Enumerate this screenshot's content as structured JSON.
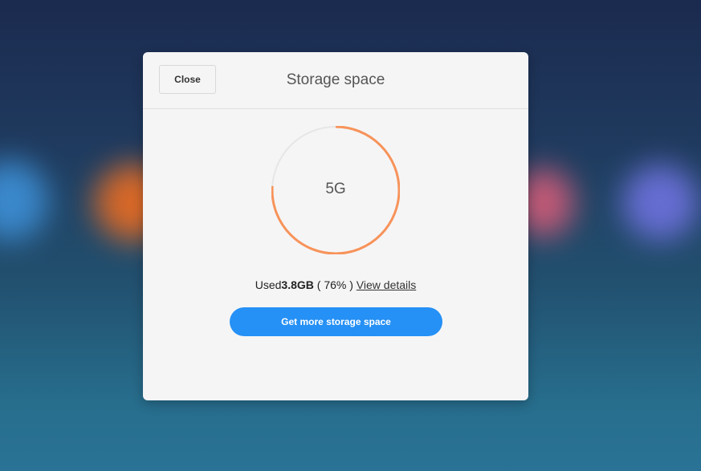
{
  "dialog": {
    "close_label": "Close",
    "title": "Storage space"
  },
  "storage": {
    "capacity_label": "5G",
    "used_prefix": "Used",
    "used_amount": "3.8GB",
    "used_percent_text": "( 76% )",
    "used_fraction": 0.76,
    "details_link": "View details",
    "cta_label": "Get more storage space"
  },
  "colors": {
    "ring_used": "#f7935a",
    "ring_track": "#e6e6e6",
    "cta": "#2590f5"
  }
}
